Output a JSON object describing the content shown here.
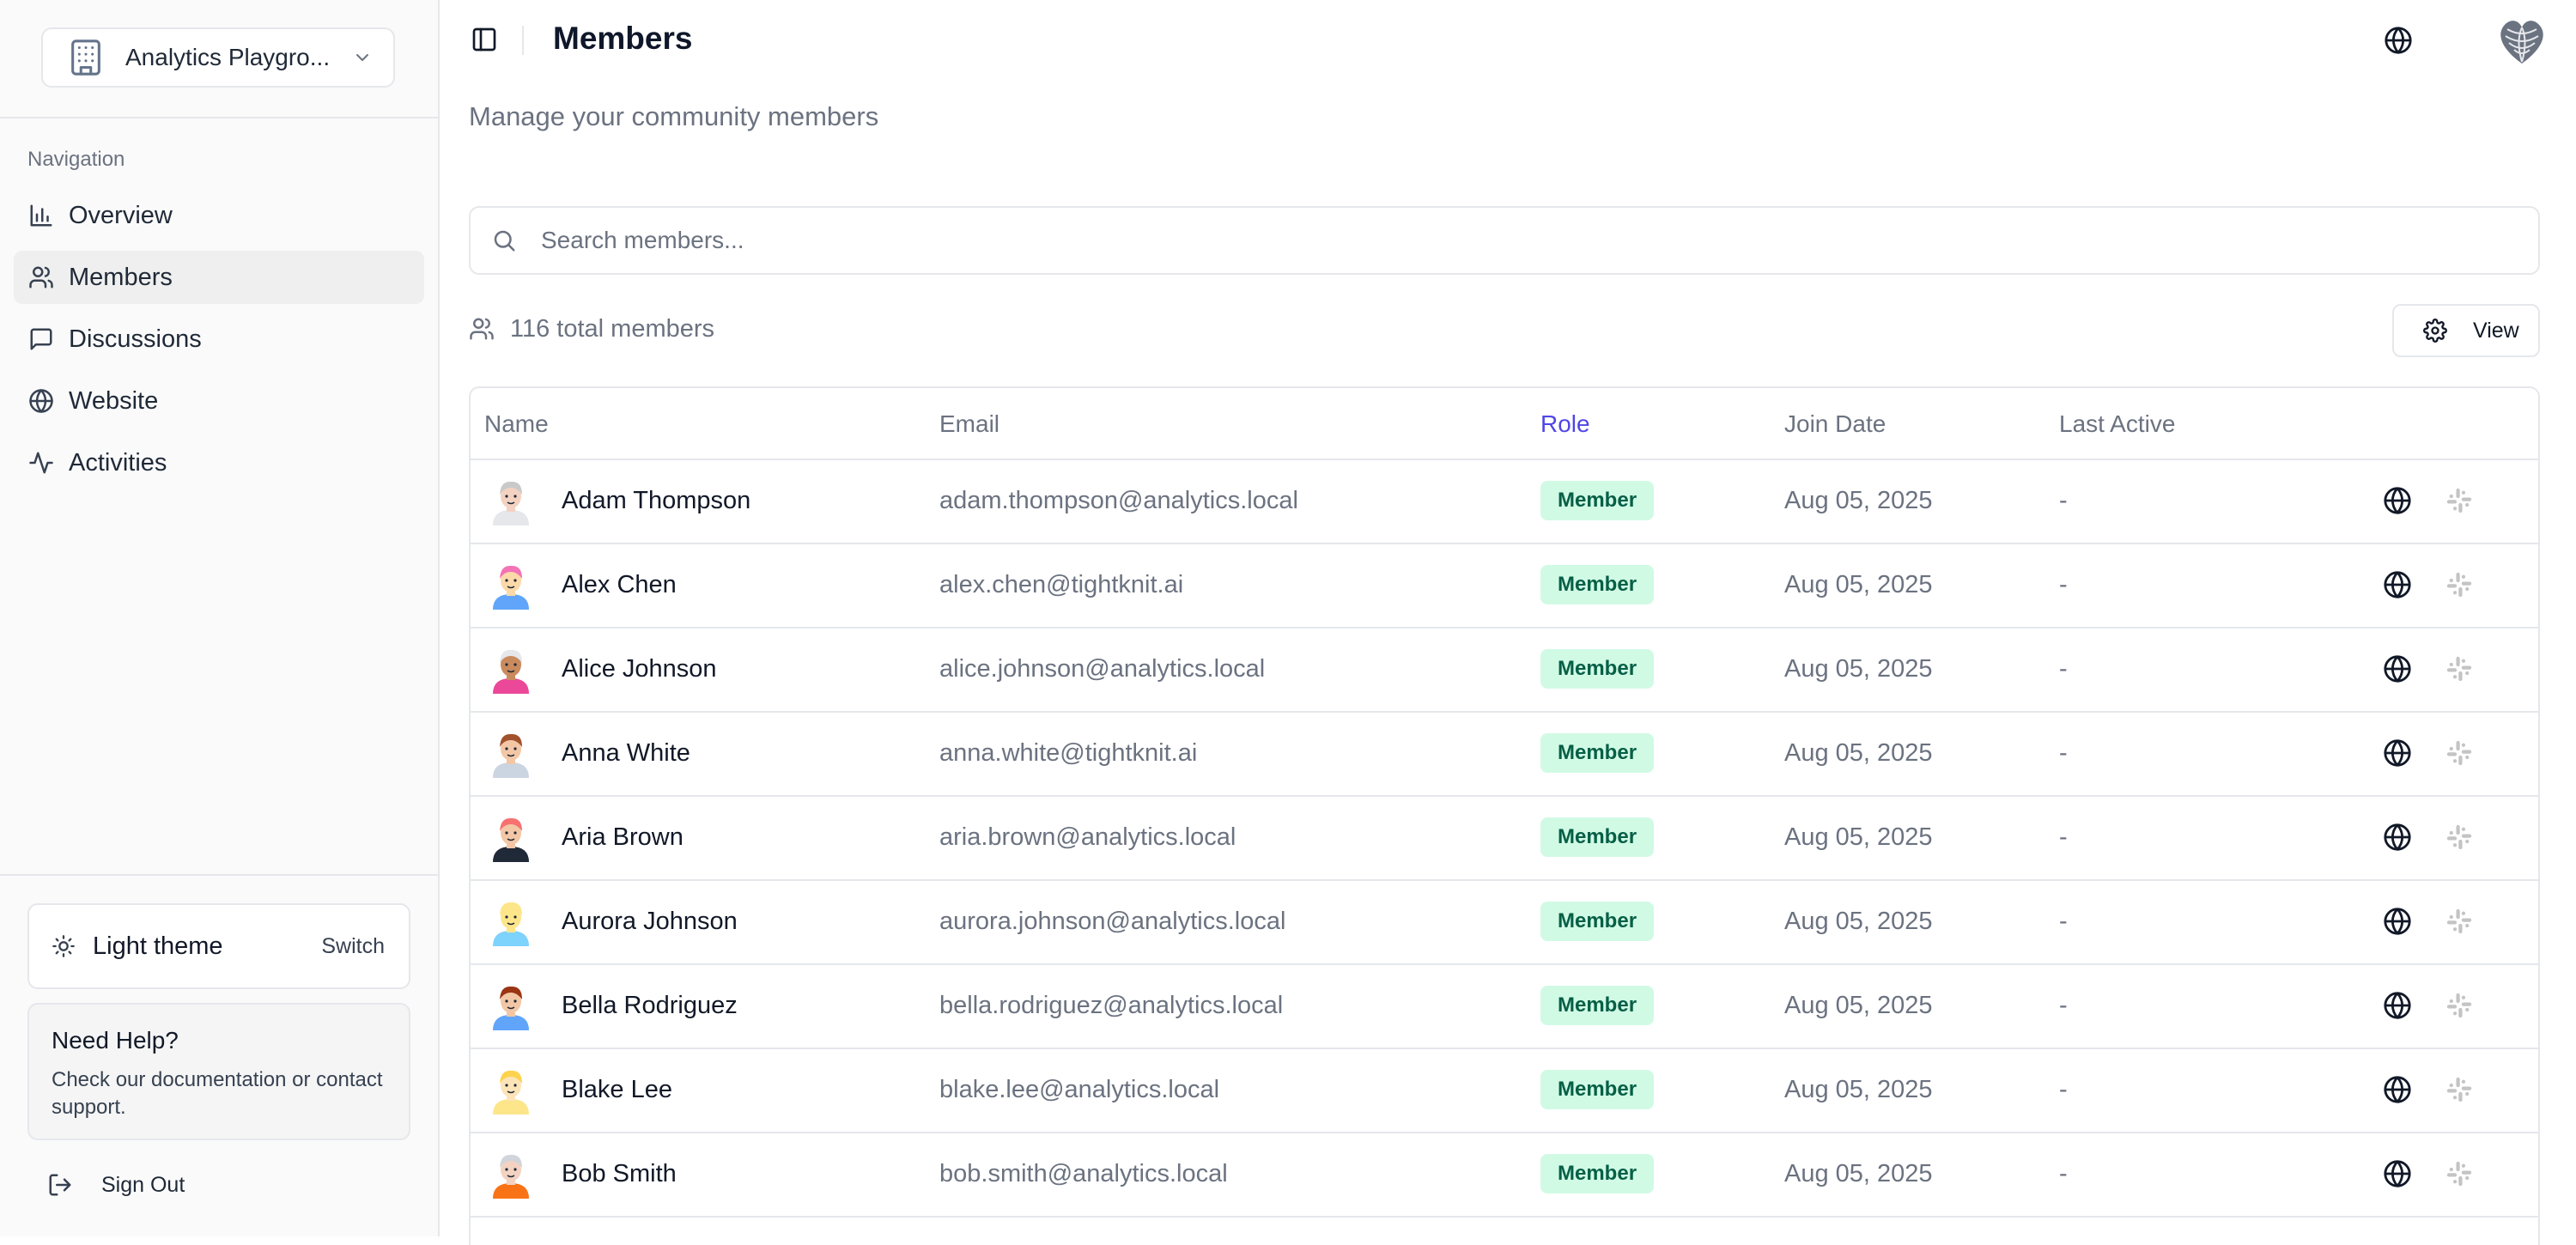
{
  "sidebar": {
    "org_name": "Analytics Playgro...",
    "nav_heading": "Navigation",
    "items": [
      {
        "label": "Overview",
        "icon": "bar-chart-icon"
      },
      {
        "label": "Members",
        "icon": "users-icon",
        "active": true
      },
      {
        "label": "Discussions",
        "icon": "message-square-icon"
      },
      {
        "label": "Website",
        "icon": "globe-icon"
      },
      {
        "label": "Activities",
        "icon": "activity-icon"
      }
    ],
    "theme_label": "Light theme",
    "theme_switch": "Switch",
    "help_title": "Need Help?",
    "help_text": "Check our documentation or contact support.",
    "signout": "Sign Out"
  },
  "header": {
    "title": "Members",
    "subtitle": "Manage your community members"
  },
  "search": {
    "placeholder": "Search members..."
  },
  "summary": {
    "count_text": "116 total members",
    "view_label": "View"
  },
  "table": {
    "columns": [
      "Name",
      "Email",
      "Role",
      "Join Date",
      "Last Active"
    ],
    "rows": [
      {
        "name": "Adam Thompson",
        "email": "adam.thompson@analytics.local",
        "role": "Member",
        "join": "Aug 05, 2025",
        "last": "-",
        "avatar": {
          "skin": "#f3d2c1",
          "hair": "#c9c9c9",
          "shirt": "#e5e7eb"
        }
      },
      {
        "name": "Alex Chen",
        "email": "alex.chen@tightknit.ai",
        "role": "Member",
        "join": "Aug 05, 2025",
        "last": "-",
        "avatar": {
          "skin": "#fcd9a8",
          "hair": "#f472b6",
          "shirt": "#60a5fa"
        }
      },
      {
        "name": "Alice Johnson",
        "email": "alice.johnson@analytics.local",
        "role": "Member",
        "join": "Aug 05, 2025",
        "last": "-",
        "avatar": {
          "skin": "#c98a5e",
          "hair": "#e5e7eb",
          "shirt": "#ec4899"
        }
      },
      {
        "name": "Anna White",
        "email": "anna.white@tightknit.ai",
        "role": "Member",
        "join": "Aug 05, 2025",
        "last": "-",
        "avatar": {
          "skin": "#f3c7a6",
          "hair": "#a0522d",
          "shirt": "#cbd5e1"
        }
      },
      {
        "name": "Aria Brown",
        "email": "aria.brown@analytics.local",
        "role": "Member",
        "join": "Aug 05, 2025",
        "last": "-",
        "avatar": {
          "skin": "#f3c7a6",
          "hair": "#f87171",
          "shirt": "#1f2937"
        }
      },
      {
        "name": "Aurora Johnson",
        "email": "aurora.johnson@analytics.local",
        "role": "Member",
        "join": "Aug 05, 2025",
        "last": "-",
        "avatar": {
          "skin": "#fde68a",
          "hair": "#fde68a",
          "shirt": "#7dd3fc"
        }
      },
      {
        "name": "Bella Rodriguez",
        "email": "bella.rodriguez@analytics.local",
        "role": "Member",
        "join": "Aug 05, 2025",
        "last": "-",
        "avatar": {
          "skin": "#f3c7a6",
          "hair": "#9a3412",
          "shirt": "#60a5fa"
        }
      },
      {
        "name": "Blake Lee",
        "email": "blake.lee@analytics.local",
        "role": "Member",
        "join": "Aug 05, 2025",
        "last": "-",
        "avatar": {
          "skin": "#fde4b8",
          "hair": "#fcd34d",
          "shirt": "#fde68a"
        }
      },
      {
        "name": "Bob Smith",
        "email": "bob.smith@analytics.local",
        "role": "Member",
        "join": "Aug 05, 2025",
        "last": "-",
        "avatar": {
          "skin": "#f3d2c1",
          "hair": "#d1d5db",
          "shirt": "#f97316"
        }
      }
    ]
  },
  "colors": {
    "accent_role_header": "#4f46e5",
    "badge_bg": "#d1fae5",
    "badge_text": "#065f46",
    "active_nav_bg": "#efefef"
  }
}
